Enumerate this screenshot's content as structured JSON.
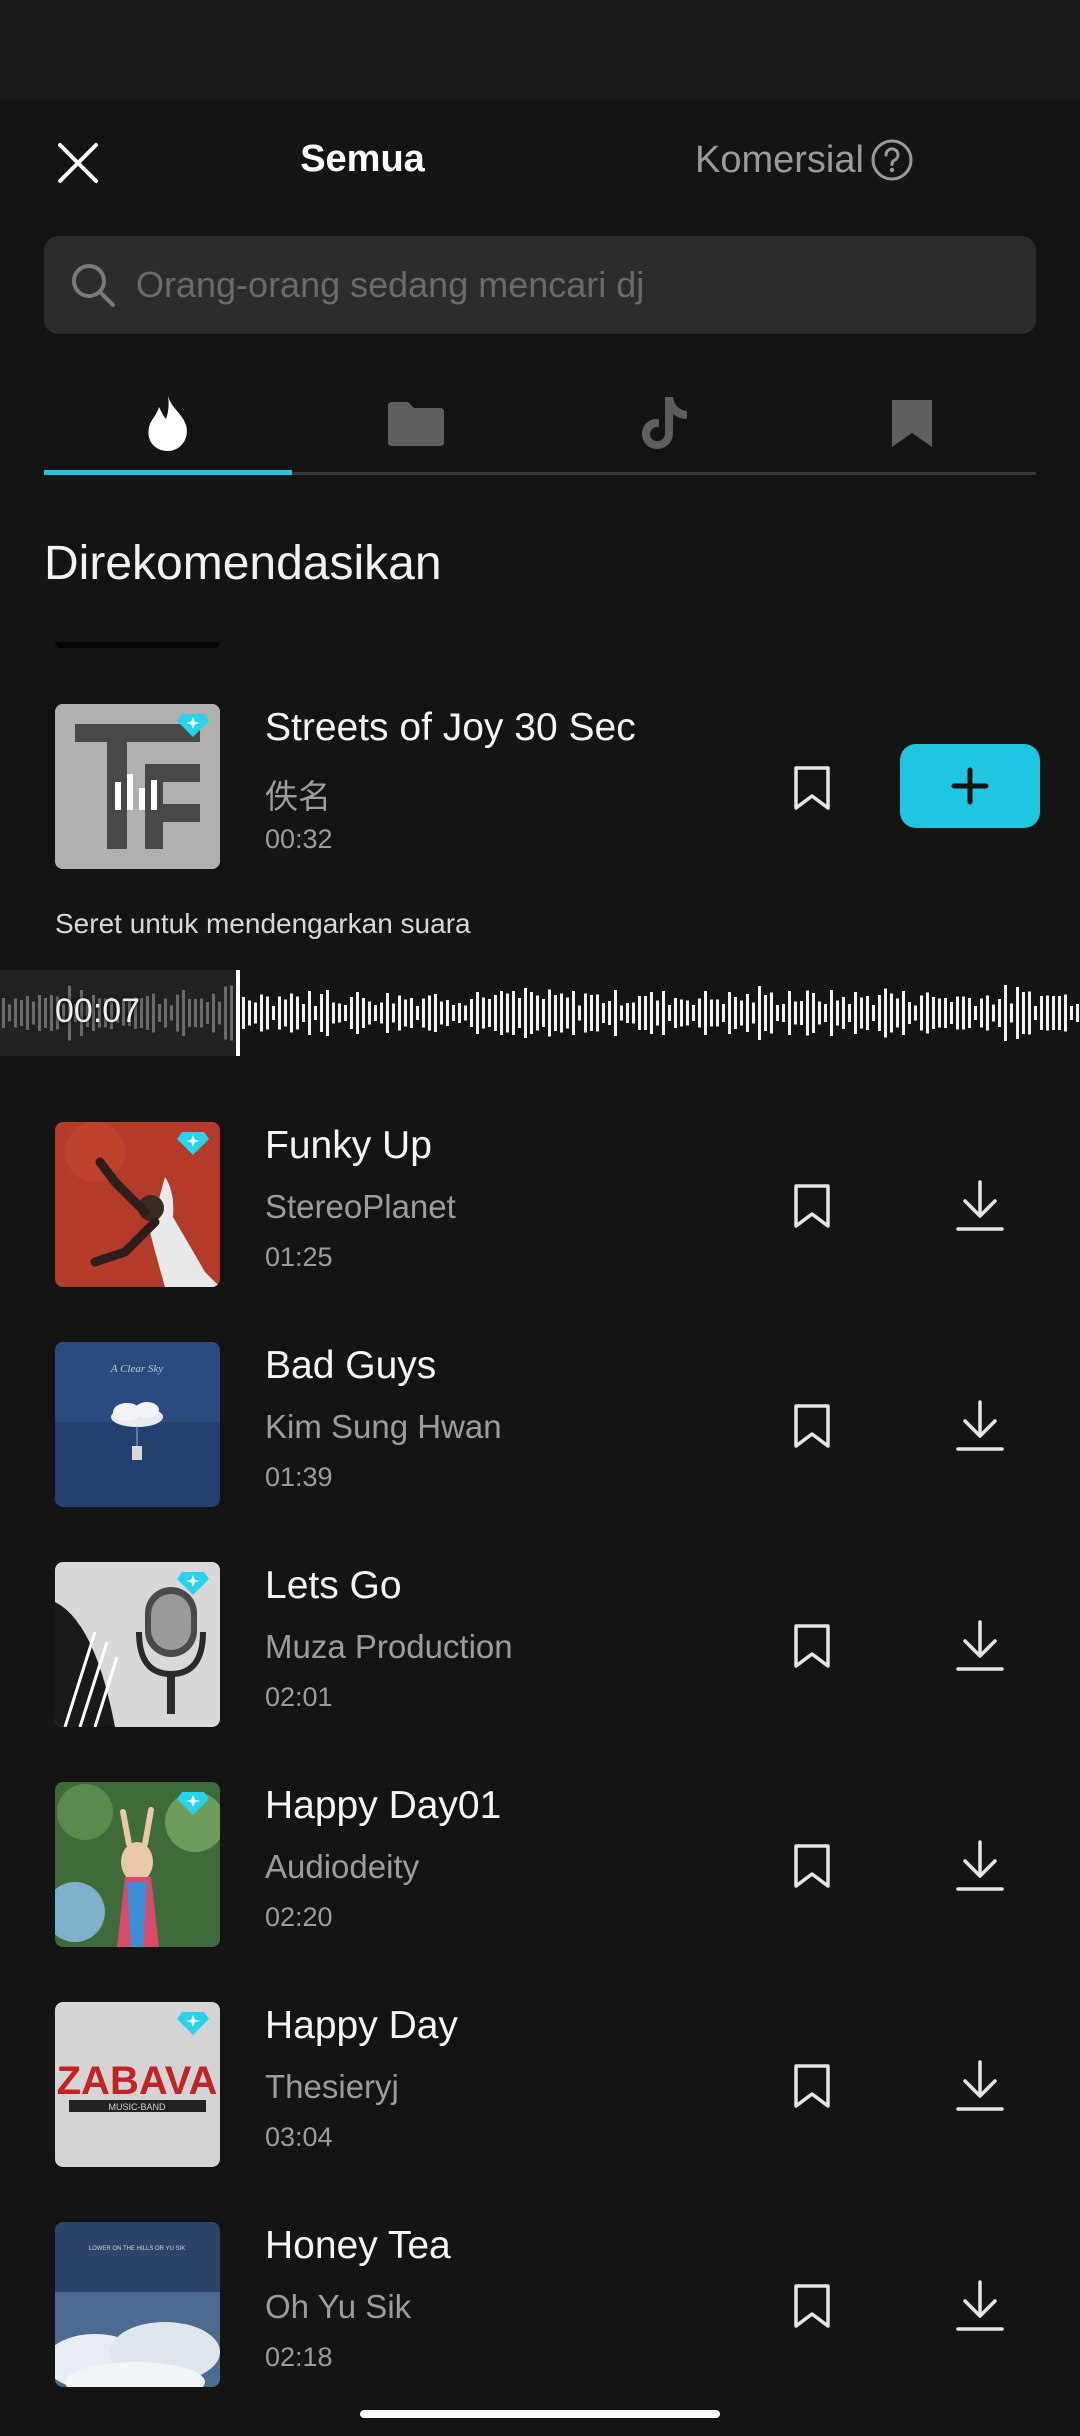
{
  "header": {
    "title": "Semua",
    "commercial_label": "Komersial"
  },
  "search": {
    "placeholder": "Orang-orang sedang mencari dj"
  },
  "tabs": [
    {
      "icon": "flame-icon",
      "active": true
    },
    {
      "icon": "folder-icon",
      "active": false
    },
    {
      "icon": "tiktok-icon",
      "active": false
    },
    {
      "icon": "bookmark-filled-icon",
      "active": false
    }
  ],
  "section_title": "Direkomendasikan",
  "playing": {
    "title": "Streets of Joy 30 Sec",
    "artist": "佚名",
    "duration": "00:32",
    "hint": "Seret untuk mendengarkan suara",
    "position": "00:07"
  },
  "songs": [
    {
      "title": "Funky Up",
      "artist": "StereoPlanet",
      "duration": "01:25"
    },
    {
      "title": "Bad Guys",
      "artist": "Kim Sung Hwan",
      "duration": "01:39"
    },
    {
      "title": "Lets Go",
      "artist": "Muza Production",
      "duration": "02:01"
    },
    {
      "title": "Happy Day01",
      "artist": "Audiodeity",
      "duration": "02:20"
    },
    {
      "title": "Happy Day",
      "artist": "Thesieryj",
      "duration": "03:04"
    },
    {
      "title": "Honey Tea",
      "artist": "Oh Yu Sik",
      "duration": "02:18"
    }
  ],
  "covers": {
    "bad_guys_text": "A Clear Sky",
    "zabava_text": "ZABAVA",
    "zabava_sub": "MUSIC-BAND",
    "honey_text": "LOWER ON THE HILLS OR YU SIK"
  },
  "colors": {
    "accent": "#1fc6e1",
    "background": "#141414",
    "premium_gem": "#27d3ec"
  }
}
